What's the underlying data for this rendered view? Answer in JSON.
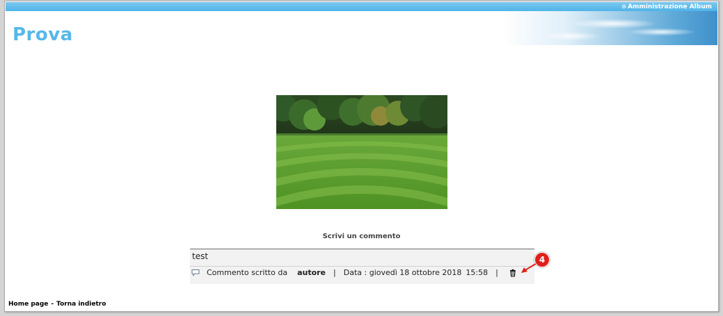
{
  "header": {
    "admin_link": "Amministrazione Album",
    "album_title": "Prova"
  },
  "comments": {
    "heading": "Scrivi un commento",
    "items": [
      {
        "text": "test",
        "written_by_label": "Commento scritto da",
        "author": "autore",
        "date_label": "Data : giovedì 18 ottobre 2018",
        "time": "15:58"
      }
    ]
  },
  "annotation": {
    "marker": "4"
  },
  "footer": {
    "home_link": "Home page",
    "separator": "-",
    "back_link": "Torna indietro"
  },
  "colors": {
    "accent": "#56b8ea",
    "topbar": "#4fb4e8",
    "marker": "#e0201a"
  }
}
